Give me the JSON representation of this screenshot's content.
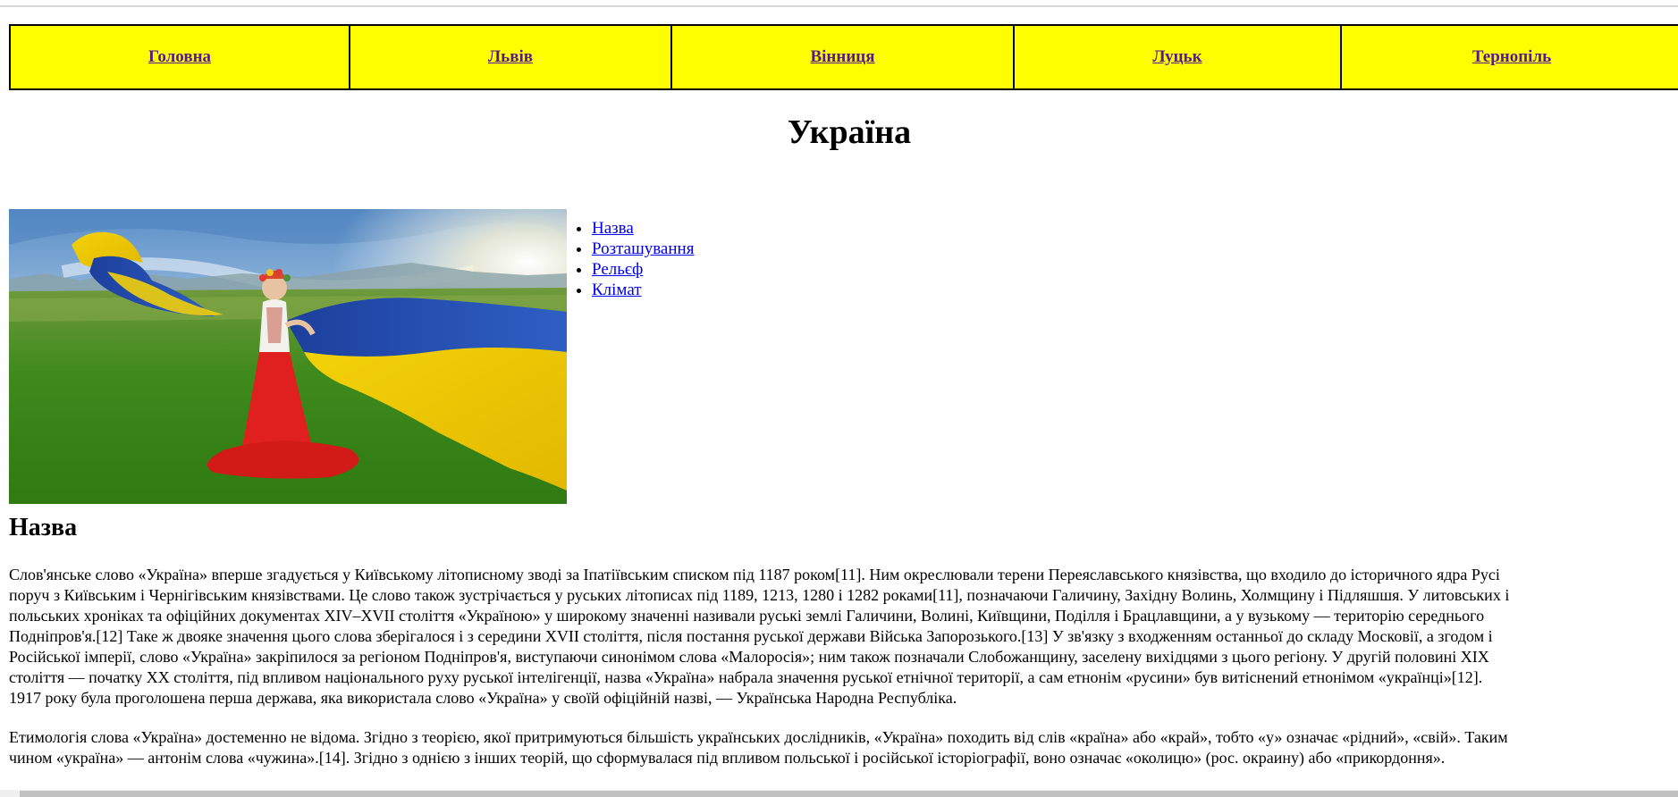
{
  "nav": {
    "items": [
      {
        "label": "Головна"
      },
      {
        "label": "Львів"
      },
      {
        "label": "Вінниця"
      },
      {
        "label": "Луцьк"
      },
      {
        "label": "Тернопіль"
      }
    ]
  },
  "page": {
    "title": "Україна"
  },
  "toc": {
    "items": [
      {
        "label": "Назва"
      },
      {
        "label": "Розташування"
      },
      {
        "label": "Рельєф"
      },
      {
        "label": "Клімат"
      }
    ]
  },
  "section": {
    "title": "Назва",
    "paragraph1": "Слов'янське слово «Україна» вперше згадується у Київському літописному зводі за Іпатіївським списком під 1187 роком[11]. Ним окреслювали терени Переяславського князівства, що входило до історичного ядра Русі\nпоруч з Київським і Чернігівським князівствами. Це слово також зустрічається у руських літописах під 1189, 1213, 1280 і 1282 роками[11], позначаючи Галичину, Західну Волинь, Холмщину і Підляшшя. У литовських і\nпольських хроніках та офіційних документах XIV–XVII століття «Україною» у широкому значенні називали руські землі Галичини, Волині, Київщини, Поділля і Брацлавщини, а у вузькому — територію середнього\nПодніпров'я.[12] Таке ж двояке значення цього слова зберігалося і з середини XVII століття, після постання руської держави Війська Запорозького.[13] У зв'язку з входженням останньої до складу Московії, а згодом і\nРосійської імперії, слово «Україна» закріпилося за регіоном Подніпров'я, виступаючи синонімом слова «Малоросія»; ним також позначали Слобожанщину, заселену вихідцями з цього регіону. У другій половині XIX\nстоліття — початку XX століття, під впливом національного руху руської інтелігенції, назва «Україна» набрала значення руської етнічної території, а сам етнонім «русини» був витіснений етнонімом «українці»[12].\n1917 року була проголошена перша держава, яка використала слово «Україна» у своїй офіційній назві, — Українська Народна Республіка.",
    "paragraph2": "Етимологія слова «Україна» достеменно не відома. Згідно з теорією, якої притримуються більшість українських дослідників, «Україна» походить від слів «країна» або «край», тобто «у» означає «рідний», «свій». Таким\nчином «україна» — антонім слова «чужина».[14]. Згідно з однією з інших теорій, що сформувалася під впливом польської і російської історіографії, воно означає «околицю» (рос. окраину) або «прикордоння»."
  },
  "colors": {
    "nav_bg": "#ffff00",
    "visited_link": "#551a8b",
    "link": "#0000ee"
  }
}
